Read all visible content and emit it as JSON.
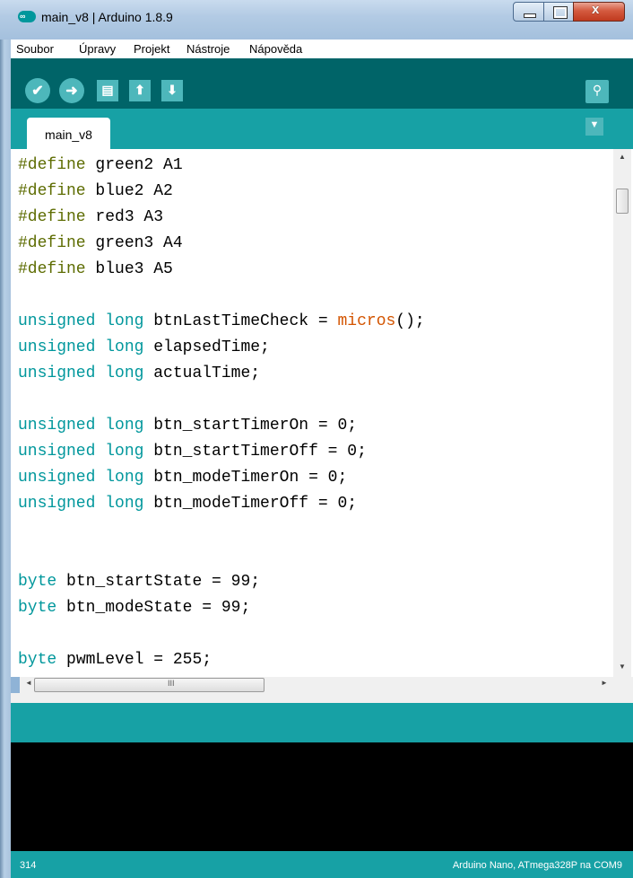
{
  "window": {
    "title": "main_v8 | Arduino 1.8.9",
    "logo_text": "∞",
    "controls": {
      "minimize": "–",
      "maximize": "□",
      "close": "x"
    }
  },
  "menu": [
    "Soubor",
    "Úpravy",
    "Projekt",
    "Nástroje",
    "Nápověda"
  ],
  "toolbar": {
    "buttons": [
      {
        "name": "verify",
        "icon": "check-icon",
        "glyph": "✔"
      },
      {
        "name": "upload",
        "icon": "arrow-right-icon",
        "glyph": "➜"
      },
      {
        "name": "new",
        "icon": "file-icon",
        "glyph": "▤"
      },
      {
        "name": "open",
        "icon": "arrow-up-icon",
        "glyph": "⬆"
      },
      {
        "name": "save",
        "icon": "arrow-down-icon",
        "glyph": "⬇"
      }
    ],
    "serial_monitor": {
      "icon": "magnifier-icon",
      "glyph": "⚲"
    }
  },
  "tabs": [
    {
      "label": "main_v8",
      "active": true
    }
  ],
  "tab_menu_glyph": "▼",
  "editor": {
    "colors": {
      "keyword": "#5e6d03",
      "type": "#00979c",
      "function": "#d35400"
    },
    "lines": [
      "#define green2 A1",
      "#define blue2 A2",
      "#define red3 A3",
      "#define green3 A4",
      "#define blue3 A5",
      "",
      "unsigned long btnLastTimeCheck = micros();",
      "unsigned long elapsedTime;",
      "unsigned long actualTime;",
      "",
      "unsigned long btn_startTimerOn = 0;",
      "unsigned long btn_startTimerOff = 0;",
      "unsigned long btn_modeTimerOn = 0;",
      "unsigned long btn_modeTimerOff = 0;",
      "",
      "",
      "byte btn_startState = 99;",
      "byte btn_modeState = 99;",
      "",
      "byte pwmLevel = 255;"
    ]
  },
  "scrollbars": {
    "up": "▲",
    "down": "▼",
    "left": "◄",
    "right": "►",
    "grip": "III"
  },
  "status": {
    "line_number": "314",
    "board": "Arduino Nano, ATmega328P na COM9"
  }
}
